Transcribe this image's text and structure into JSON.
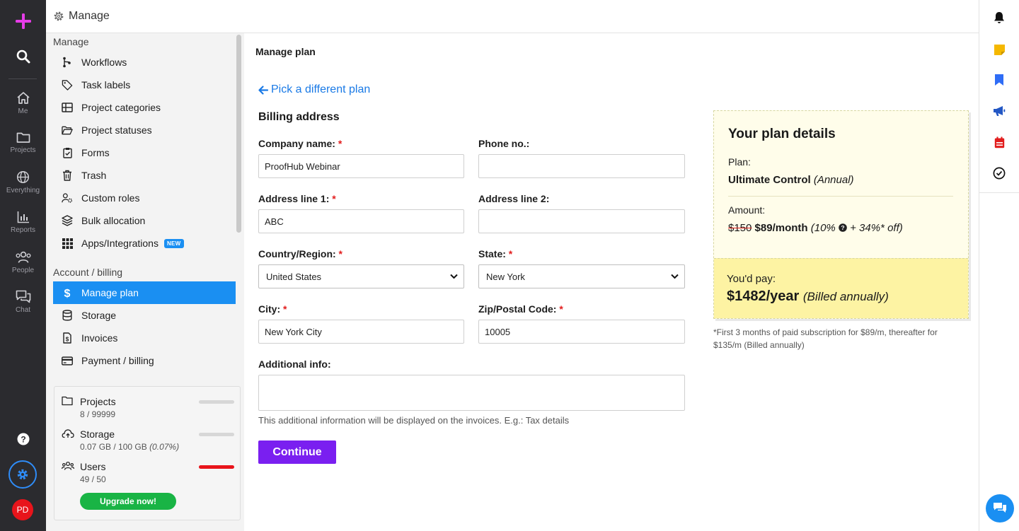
{
  "header": {
    "title": "Manage"
  },
  "rail": {
    "items": [
      {
        "label": "Me"
      },
      {
        "label": "Projects"
      },
      {
        "label": "Everything"
      },
      {
        "label": "Reports"
      },
      {
        "label": "People"
      },
      {
        "label": "Chat"
      }
    ],
    "avatar_initials": "PD"
  },
  "sidebar": {
    "manage_heading": "Manage",
    "manage_items": [
      {
        "label": "Workflows",
        "icon": "workflow-icon"
      },
      {
        "label": "Task labels",
        "icon": "tag-icon"
      },
      {
        "label": "Project categories",
        "icon": "grid-icon"
      },
      {
        "label": "Project statuses",
        "icon": "folder-open-icon"
      },
      {
        "label": "Forms",
        "icon": "clipboard-icon"
      },
      {
        "label": "Trash",
        "icon": "trash-icon"
      },
      {
        "label": "Custom roles",
        "icon": "user-settings-icon"
      },
      {
        "label": "Bulk allocation",
        "icon": "layers-icon"
      },
      {
        "label": "Apps/Integrations",
        "icon": "apps-grid-icon",
        "badge": "NEW"
      }
    ],
    "account_heading": "Account / billing",
    "account_items": [
      {
        "label": "Manage plan",
        "icon": "dollar-icon",
        "active": true
      },
      {
        "label": "Storage",
        "icon": "database-icon"
      },
      {
        "label": "Invoices",
        "icon": "invoice-icon"
      },
      {
        "label": "Payment / billing",
        "icon": "credit-card-icon"
      }
    ],
    "usage": {
      "projects": {
        "label": "Projects",
        "sub": "8 / 99999",
        "fraction": 0.0001
      },
      "storage": {
        "label": "Storage",
        "sub_main": "0.07 GB / 100 GB ",
        "sub_pct": "(0.07%)",
        "fraction": 0.0007
      },
      "users": {
        "label": "Users",
        "sub": "49 / 50",
        "fraction": 0.98
      },
      "upgrade_label": "Upgrade now!"
    }
  },
  "main": {
    "title": "Manage plan",
    "back_link": "Pick a different plan",
    "section_title": "Billing address",
    "fields": {
      "company_label": "Company name:",
      "company_value": "ProofHub Webinar",
      "phone_label": "Phone no.:",
      "phone_value": "",
      "addr1_label": "Address line 1:",
      "addr1_value": "ABC",
      "addr2_label": "Address line 2:",
      "addr2_value": "",
      "country_label": "Country/Region:",
      "country_value": "United States",
      "state_label": "State:",
      "state_value": "New York",
      "city_label": "City:",
      "city_value": "New York City",
      "zip_label": "Zip/Postal Code:",
      "zip_value": "10005",
      "info_label": "Additional info:",
      "required_mark": "*"
    },
    "helper_text": "This additional information will be displayed on the invoices. E.g.: Tax details",
    "continue_label": "Continue"
  },
  "plan": {
    "title": "Your plan details",
    "plan_label": "Plan:",
    "plan_name": "Ultimate Control",
    "plan_period": "(Annual)",
    "amount_label": "Amount:",
    "old_price": "$150",
    "new_price": "$89/month",
    "discount_a": "(10%",
    "discount_b": "+ 34%* off)",
    "pay_label": "You'd pay:",
    "pay_amount": "$1482/year",
    "pay_note": "(Billed annually)",
    "footnote": "*First 3 months of paid subscription for $89/m, thereafter for $135/m (Billed annually)"
  },
  "colors": {
    "accent": "#1a8ff2",
    "continue": "#7a1ff0",
    "upgrade": "#19b445",
    "users_bar": "#e8141b",
    "plus": "#e63ce8"
  }
}
